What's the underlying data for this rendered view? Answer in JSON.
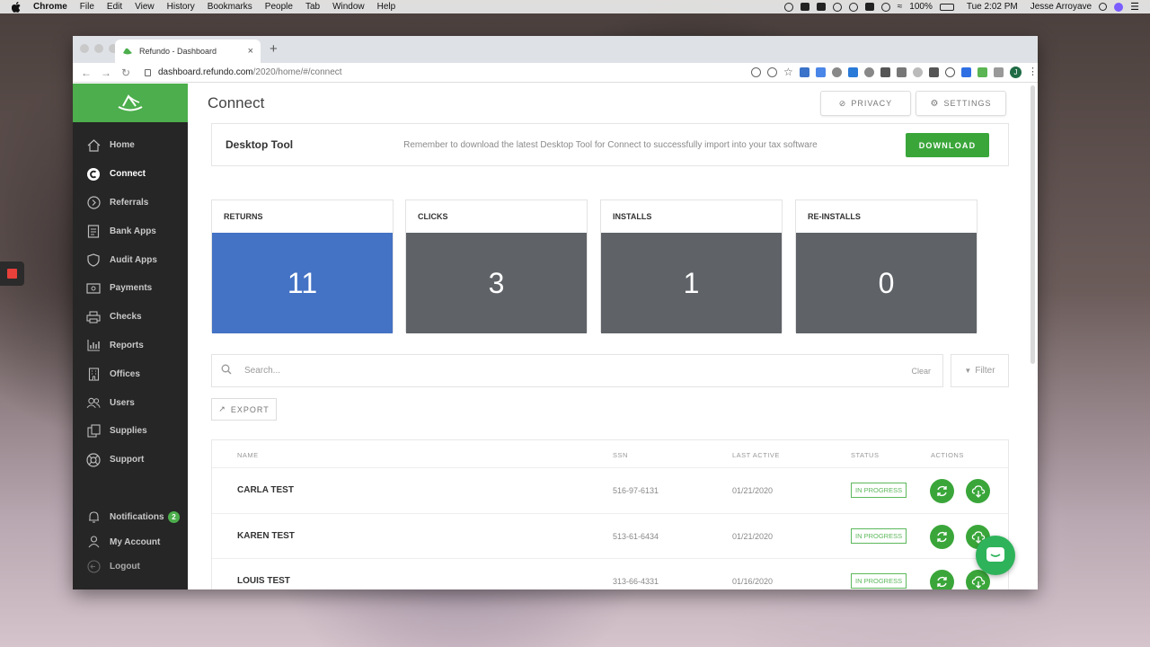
{
  "menubar": {
    "items": [
      "Chrome",
      "File",
      "Edit",
      "View",
      "History",
      "Bookmarks",
      "People",
      "Tab",
      "Window",
      "Help"
    ],
    "battery": "100%",
    "clock": "Tue 2:02 PM",
    "user": "Jesse Arroyave"
  },
  "browser": {
    "tab_title": "Refundo - Dashboard",
    "url_host": "dashboard.refundo.com",
    "url_path": "/2020/home/#/connect",
    "profile_initial": "J"
  },
  "sidebar": {
    "items": [
      {
        "label": "Home",
        "icon": "home-icon"
      },
      {
        "label": "Connect",
        "icon": "connect-icon"
      },
      {
        "label": "Referrals",
        "icon": "referrals-icon"
      },
      {
        "label": "Bank Apps",
        "icon": "bank-apps-icon"
      },
      {
        "label": "Audit Apps",
        "icon": "shield-icon"
      },
      {
        "label": "Payments",
        "icon": "payments-icon"
      },
      {
        "label": "Checks",
        "icon": "printer-icon"
      },
      {
        "label": "Reports",
        "icon": "bar-chart-icon"
      },
      {
        "label": "Offices",
        "icon": "building-icon"
      },
      {
        "label": "Users",
        "icon": "users-icon"
      },
      {
        "label": "Supplies",
        "icon": "supplies-icon"
      },
      {
        "label": "Support",
        "icon": "lifebuoy-icon"
      }
    ],
    "notifications_label": "Notifications",
    "notifications_count": "2",
    "account_label": "My Account",
    "logout_label": "Logout"
  },
  "page": {
    "title": "Connect",
    "privacy_label": "PRIVACY",
    "settings_label": "SETTINGS"
  },
  "banner": {
    "title": "Desktop Tool",
    "message": "Remember to download the latest Desktop Tool for Connect to successfully import into your tax software",
    "download_label": "DOWNLOAD"
  },
  "stats": [
    {
      "label": "RETURNS",
      "value": "11",
      "color": "#4472c4"
    },
    {
      "label": "CLICKS",
      "value": "3",
      "color": "#5f6368"
    },
    {
      "label": "INSTALLS",
      "value": "1",
      "color": "#5f6368"
    },
    {
      "label": "RE-INSTALLS",
      "value": "0",
      "color": "#5f6368"
    }
  ],
  "search": {
    "placeholder": "Search...",
    "clear_label": "Clear",
    "filter_label": "Filter"
  },
  "export_label": "EXPORT",
  "table": {
    "columns": [
      "NAME",
      "SSN",
      "LAST ACTIVE",
      "STATUS",
      "ACTIONS"
    ],
    "rows": [
      {
        "name": "CARLA TEST",
        "ssn": "516-97-6131",
        "last_active": "01/21/2020",
        "status": "IN PROGRESS"
      },
      {
        "name": "KAREN TEST",
        "ssn": "513-61-6434",
        "last_active": "01/21/2020",
        "status": "IN PROGRESS"
      },
      {
        "name": "LOUIS TEST",
        "ssn": "313-66-4331",
        "last_active": "01/16/2020",
        "status": "IN PROGRESS"
      }
    ]
  },
  "colors": {
    "brand_green": "#4cae4c",
    "button_green": "#3aa63a",
    "sidebar_bg": "#262626",
    "returns_blue": "#4472c4",
    "stat_gray": "#5f6368"
  }
}
